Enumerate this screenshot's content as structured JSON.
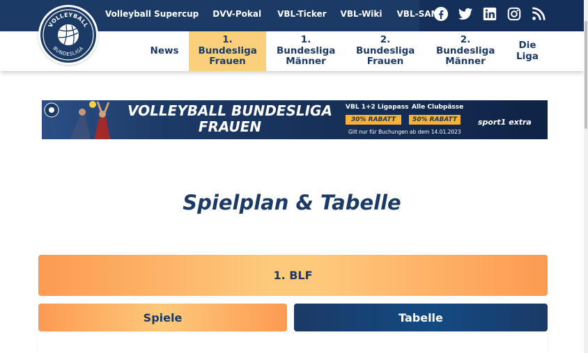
{
  "topnav": {
    "links": [
      "Volleyball Supercup",
      "DVV-Pokal",
      "VBL-Ticker",
      "VBL-Wiki",
      "VBL-SAMS"
    ],
    "social_icons": [
      "facebook-icon",
      "twitter-icon",
      "linkedin-icon",
      "instagram-icon",
      "rss-icon"
    ]
  },
  "logo": {
    "line1": "VOLLEYBALL",
    "line2": "BUNDESLIGA"
  },
  "mainnav": {
    "items": [
      {
        "label": "News",
        "active": false
      },
      {
        "label": "1. Bundesliga Frauen",
        "active": true
      },
      {
        "label": "1. Bundesliga Männer",
        "active": false
      },
      {
        "label": "2. Bundesliga Frauen",
        "active": false
      },
      {
        "label": "2. Bundesliga Männer",
        "active": false
      },
      {
        "label": "Die Liga",
        "active": false
      }
    ]
  },
  "banner": {
    "title_line1": "VOLLEYBALL BUNDESLIGA",
    "title_line2": "FRAUEN",
    "offer1_label": "VBL 1+2 Ligapass",
    "offer1_discount": "30% RABATT",
    "offer2_label": "Alle Clubpässe",
    "offer2_discount": "50% RABATT",
    "footnote": "Gilt nur für Buchungen ab dem 14.01.2023",
    "sponsor": "sport1 extra"
  },
  "page_title": "Spielplan & Tabelle",
  "league": "1. BLF",
  "tabs": {
    "spiele": "Spiele",
    "tabelle": "Tabelle"
  },
  "colors": {
    "navy": "#1b3a66",
    "orange": "#fd9a52",
    "peach": "#fdc97b",
    "active_nav": "#fcd07a"
  }
}
